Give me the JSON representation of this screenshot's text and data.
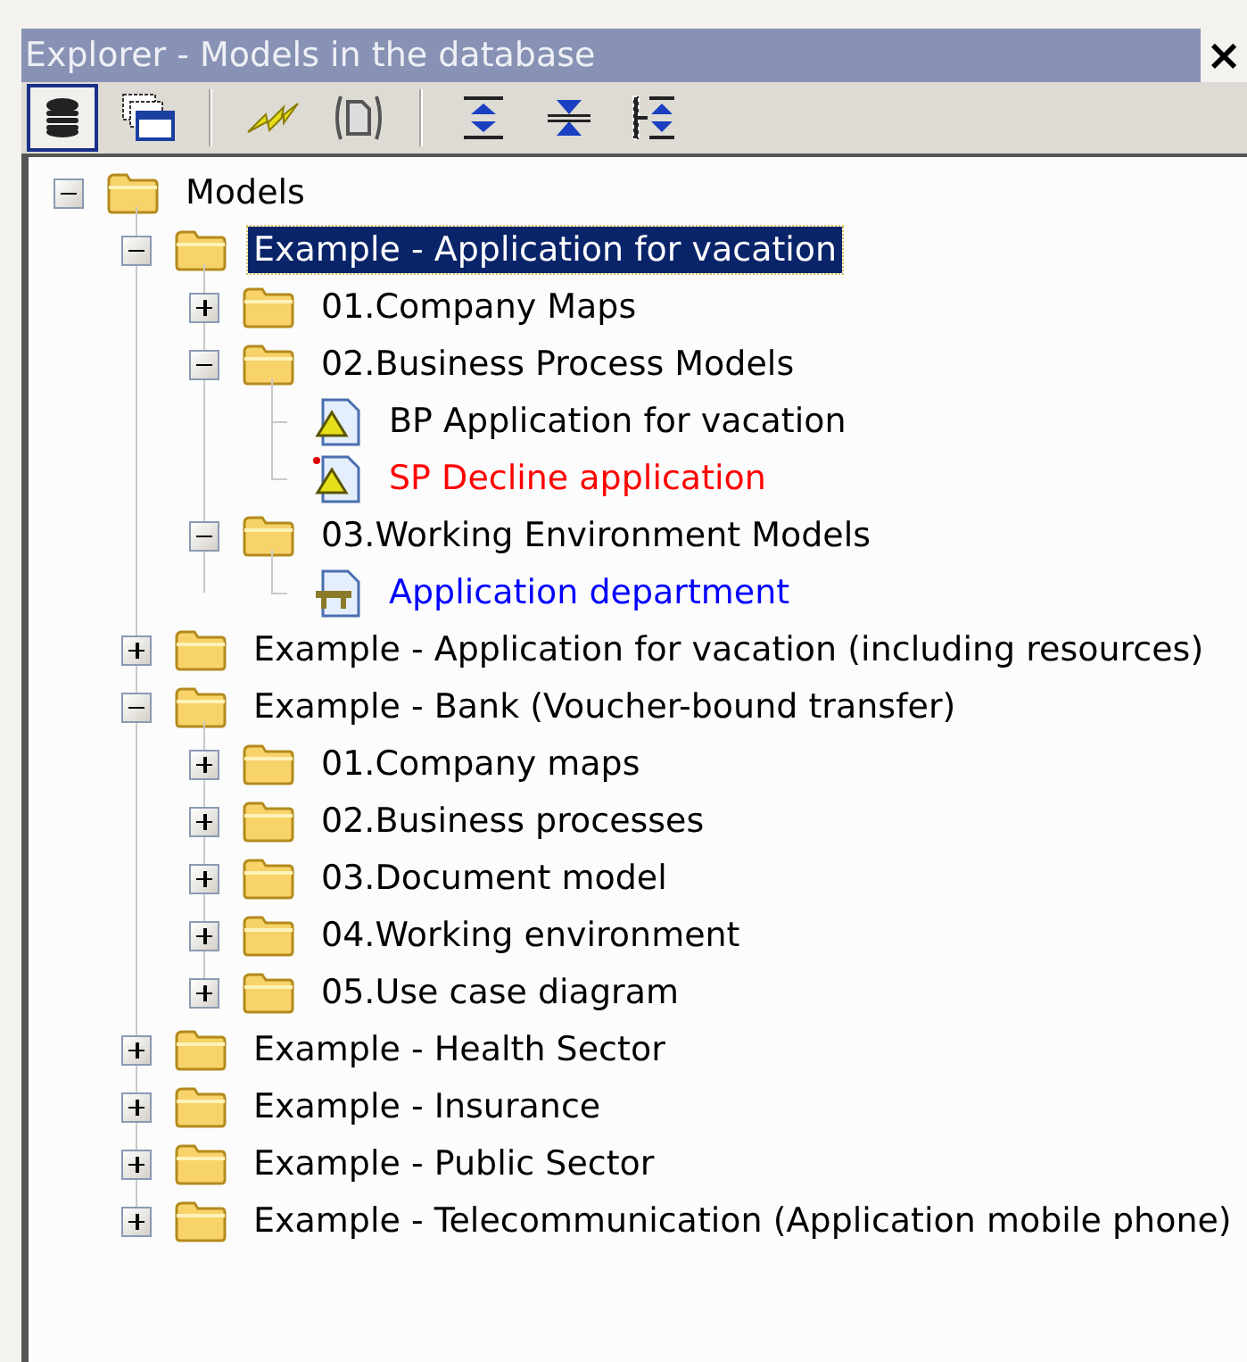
{
  "window": {
    "title": "Explorer - Models in the database",
    "close": "×"
  },
  "toolbar": [
    {
      "kind": "database",
      "pressed": true
    },
    {
      "kind": "windows",
      "pressed": false
    },
    {
      "kind": "separator"
    },
    {
      "kind": "lightning",
      "pressed": false
    },
    {
      "kind": "document",
      "pressed": false
    },
    {
      "kind": "separator"
    },
    {
      "kind": "expand",
      "pressed": false
    },
    {
      "kind": "collapse",
      "pressed": false
    },
    {
      "kind": "expand-level",
      "pressed": false
    }
  ],
  "tree": [
    {
      "label": "Models",
      "kind": "folder",
      "expanded": true,
      "selected": false,
      "children": [
        {
          "label": "Example - Application for vacation",
          "kind": "folder",
          "expanded": true,
          "selected": true,
          "children": [
            {
              "label": "01.Company Maps",
              "kind": "folder",
              "expanded": false,
              "selected": false
            },
            {
              "label": "02.Business Process Models",
              "kind": "folder",
              "expanded": true,
              "selected": false,
              "children": [
                {
                  "label": "BP Application for vacation",
                  "kind": "process",
                  "selected": false,
                  "color": "#000000"
                },
                {
                  "label": "SP Decline application",
                  "kind": "process-flagged",
                  "selected": false,
                  "color": "#ff0000"
                }
              ]
            },
            {
              "label": "03.Working Environment Models",
              "kind": "folder",
              "expanded": true,
              "selected": false,
              "children": [
                {
                  "label": "Application department",
                  "kind": "environment",
                  "selected": false,
                  "color": "#0000ff"
                }
              ]
            }
          ]
        },
        {
          "label": "Example - Application for vacation (including resources)",
          "kind": "folder",
          "expanded": false,
          "selected": false
        },
        {
          "label": "Example - Bank (Voucher-bound transfer)",
          "kind": "folder",
          "expanded": true,
          "selected": false,
          "children": [
            {
              "label": "01.Company maps",
              "kind": "folder",
              "expanded": false,
              "selected": false
            },
            {
              "label": "02.Business processes",
              "kind": "folder",
              "expanded": false,
              "selected": false
            },
            {
              "label": "03.Document model",
              "kind": "folder",
              "expanded": false,
              "selected": false
            },
            {
              "label": "04.Working environment",
              "kind": "folder",
              "expanded": false,
              "selected": false
            },
            {
              "label": "05.Use case diagram",
              "kind": "folder",
              "expanded": false,
              "selected": false
            }
          ]
        },
        {
          "label": "Example - Health Sector",
          "kind": "folder",
          "expanded": false,
          "selected": false
        },
        {
          "label": "Example - Insurance",
          "kind": "folder",
          "expanded": false,
          "selected": false
        },
        {
          "label": "Example - Public Sector",
          "kind": "folder",
          "expanded": false,
          "selected": false
        },
        {
          "label": "Example - Telecommunication (Application mobile phone)",
          "kind": "folder",
          "expanded": false,
          "selected": false
        }
      ]
    }
  ]
}
